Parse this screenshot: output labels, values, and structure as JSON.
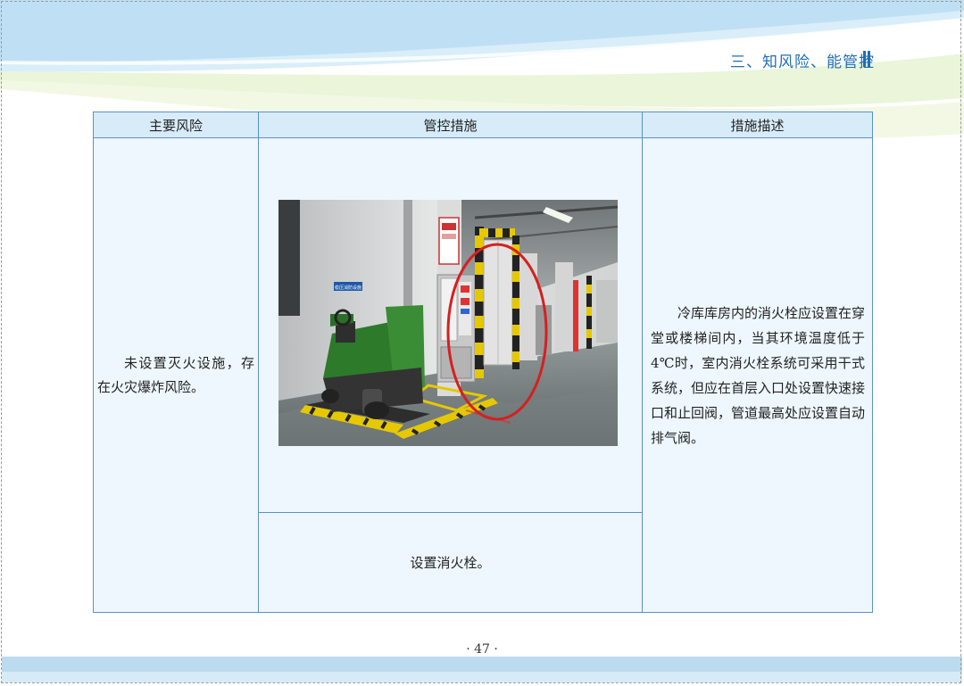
{
  "header": {
    "title": "三、知风险、能管控"
  },
  "table": {
    "headers": [
      "主要风险",
      "管控措施",
      "措施描述"
    ],
    "risk": "未设置灭火设施，存在火灾爆炸风险。",
    "measure": "设置消火栓。",
    "description": "冷库库房内的消火栓应设置在穿堂或楼梯间内，当其环境温度低于 4℃时，室内消火栓系统可采用干式系统，但应在首层入口处设置快速接口和止回阀，管道最高处应设置自动排气阀。"
  },
  "photo": {
    "sign_text": "稳压消防设施"
  },
  "footer": {
    "page_number": "· 47 ·"
  },
  "colors": {
    "accent": "#1f6fb0",
    "table_border": "#5b8fd0",
    "header_fill": "#d7ecf8",
    "cell_fill": "#eef7fd"
  }
}
